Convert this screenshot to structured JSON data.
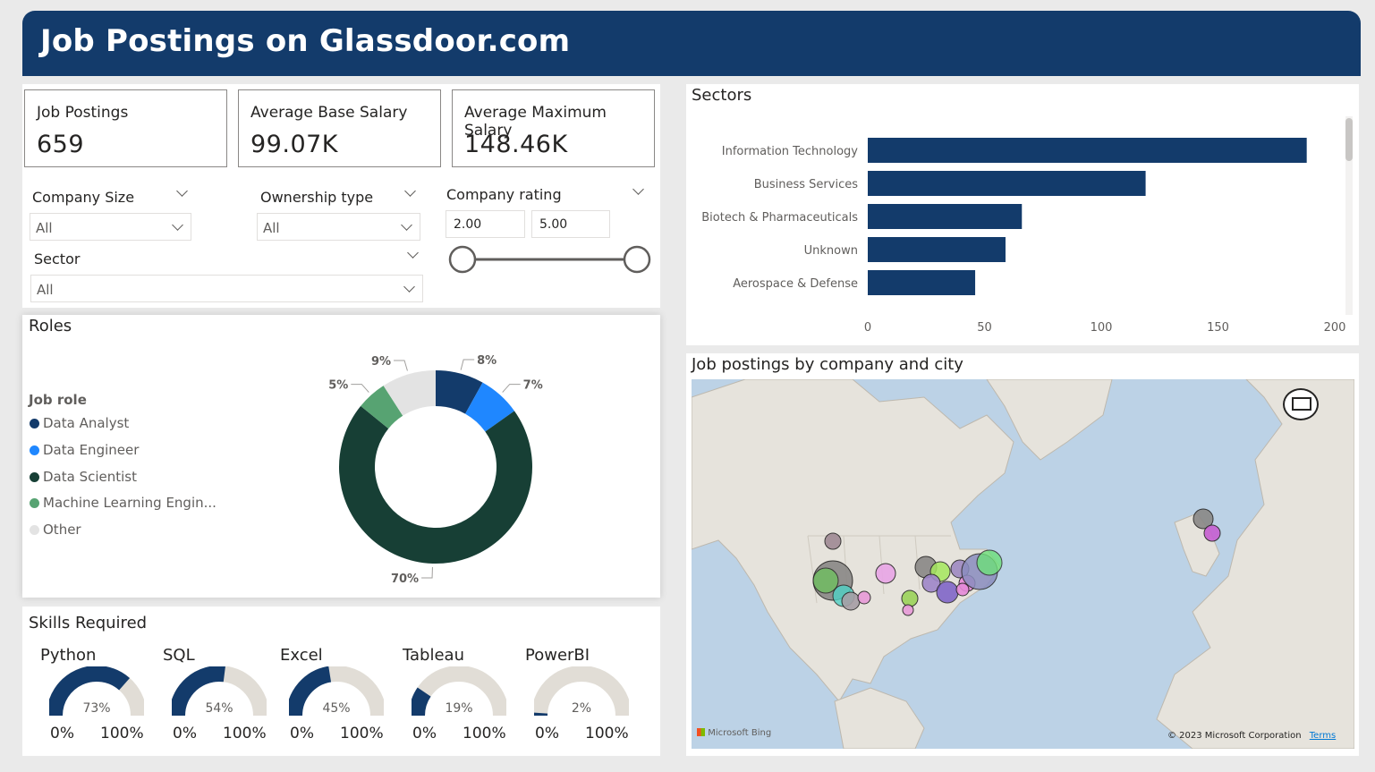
{
  "header": {
    "title": "Job Postings on Glassdoor.com"
  },
  "kpis": [
    {
      "label": "Job Postings",
      "value": "659"
    },
    {
      "label": "Average Base Salary",
      "value": "99.07K"
    },
    {
      "label": "Average Maximum Salary",
      "value": "148.46K"
    }
  ],
  "filters": {
    "company_size": {
      "title": "Company Size",
      "value": "All"
    },
    "ownership_type": {
      "title": "Ownership type",
      "value": "All"
    },
    "sector": {
      "title": "Sector",
      "value": "All"
    },
    "company_rating": {
      "title": "Company rating",
      "min_value": "2.00",
      "max_value": "5.00"
    }
  },
  "roles": {
    "title": "Roles",
    "legend_title": "Job role",
    "legend": [
      {
        "label": "Data Analyst",
        "color": "#133b6b"
      },
      {
        "label": "Data Engineer",
        "color": "#1f87ff"
      },
      {
        "label": "Data Scientist",
        "color": "#173f35"
      },
      {
        "label": "Machine Learning Engin...",
        "color": "#57a372"
      },
      {
        "label": "Other",
        "color": "#e3e3e3"
      }
    ]
  },
  "sectors": {
    "title": "Sectors"
  },
  "skills": {
    "title": "Skills Required",
    "min_label": "0%",
    "max_label": "100%",
    "items": [
      {
        "label": "Python",
        "value": 73,
        "text": "73%"
      },
      {
        "label": "SQL",
        "value": 54,
        "text": "54%"
      },
      {
        "label": "Excel",
        "value": 45,
        "text": "45%"
      },
      {
        "label": "Tableau",
        "value": 19,
        "text": "19%"
      },
      {
        "label": "PowerBI",
        "value": 2,
        "text": "2%"
      }
    ]
  },
  "map": {
    "title": "Job postings by company and city",
    "attribution": "Microsoft Bing",
    "copyright": "© 2023 Microsoft Corporation",
    "terms": "Terms"
  },
  "chart_data": [
    {
      "type": "pie",
      "title": "Roles",
      "donut": true,
      "categories": [
        "Data Analyst",
        "Data Engineer",
        "Data Scientist",
        "Machine Learning Engin...",
        "Other"
      ],
      "values": [
        8,
        7,
        70,
        5,
        9
      ],
      "labels": [
        "8%",
        "7%",
        "70%",
        "5%",
        "9%"
      ],
      "colors": [
        "#133b6b",
        "#1f87ff",
        "#173f35",
        "#57a372",
        "#e3e3e3"
      ]
    },
    {
      "type": "bar",
      "orientation": "horizontal",
      "title": "Sectors",
      "categories": [
        "Information Technology",
        "Business Services",
        "Biotech & Pharmaceuticals",
        "Unknown",
        "Aerospace & Defense"
      ],
      "values": [
        188,
        119,
        66,
        59,
        46
      ],
      "xlim": [
        0,
        200
      ],
      "ticks": [
        0,
        50,
        100,
        150,
        200
      ],
      "color": "#133b6b"
    }
  ]
}
